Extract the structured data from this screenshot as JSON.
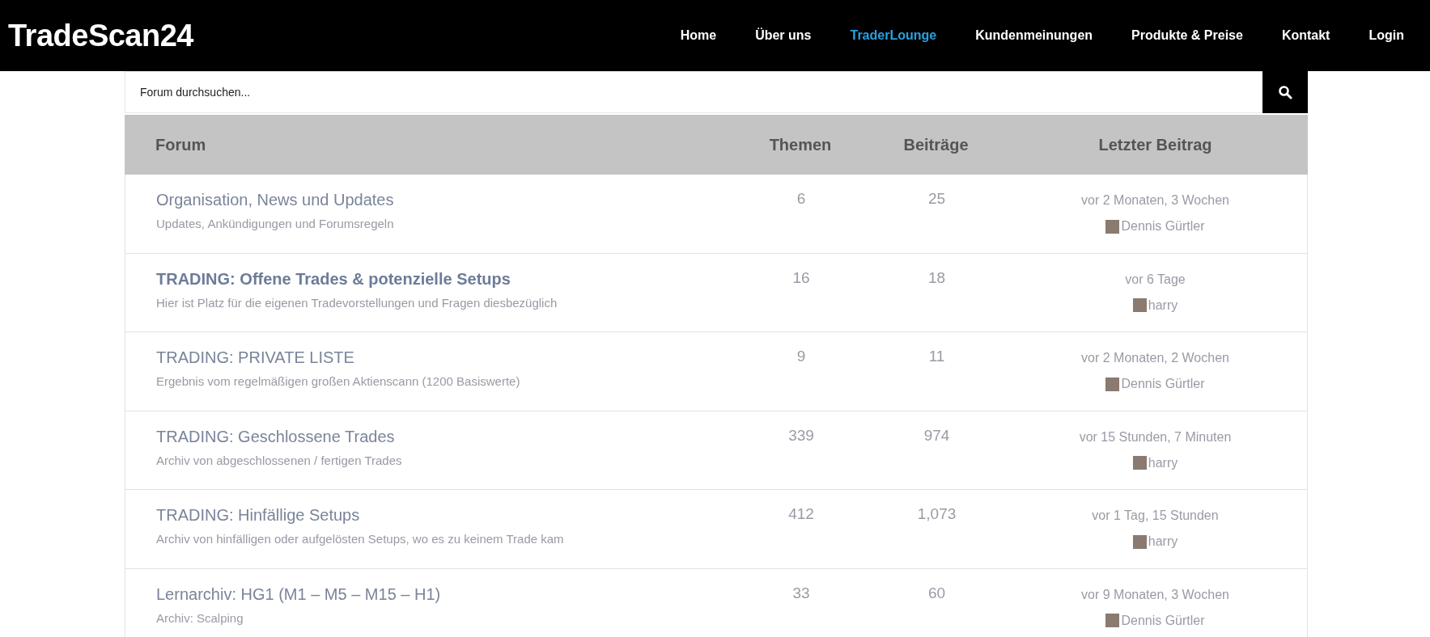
{
  "brand": "TradeScan24",
  "nav": [
    {
      "label": "Home",
      "selected": false
    },
    {
      "label": "Über uns",
      "selected": false
    },
    {
      "label": "TraderLounge",
      "selected": true
    },
    {
      "label": "Kundenmeinungen",
      "selected": false
    },
    {
      "label": "Produkte & Preise",
      "selected": false
    },
    {
      "label": "Kontakt",
      "selected": false
    },
    {
      "label": "Login",
      "selected": false
    }
  ],
  "search": {
    "placeholder": "Forum durchsuchen..."
  },
  "table": {
    "columns": [
      "Forum",
      "Themen",
      "Beiträge",
      "Letzter Beitrag"
    ],
    "rows": [
      {
        "title": "Organisation, News und Updates",
        "description": "Updates, Ankündigungen und Forumsregeln",
        "unread": false,
        "topics": "6",
        "posts": "25",
        "last_time": "vor 2 Monaten, 3 Wochen",
        "last_user": "Dennis Gürtler"
      },
      {
        "title": "TRADING: Offene Trades & potenzielle Setups",
        "description": "Hier ist Platz für die eigenen Tradevorstellungen und Fragen diesbezüglich",
        "unread": true,
        "topics": "16",
        "posts": "18",
        "last_time": "vor 6 Tage",
        "last_user": "harry"
      },
      {
        "title": "TRADING: PRIVATE LISTE",
        "description": "Ergebnis vom regelmäßigen großen Aktienscann (1200 Basiswerte)",
        "unread": false,
        "topics": "9",
        "posts": "11",
        "last_time": "vor 2 Monaten, 2 Wochen",
        "last_user": "Dennis Gürtler"
      },
      {
        "title": "TRADING: Geschlossene Trades",
        "description": "Archiv von abgeschlossenen / fertigen Trades",
        "unread": false,
        "topics": "339",
        "posts": "974",
        "last_time": "vor 15 Stunden, 7 Minuten",
        "last_user": "harry"
      },
      {
        "title": "TRADING: Hinfällige Setups",
        "description": "Archiv von hinfälligen oder aufgelösten Setups, wo es zu keinem Trade kam",
        "unread": false,
        "topics": "412",
        "posts": "1,073",
        "last_time": "vor 1 Tag, 15 Stunden",
        "last_user": "harry"
      },
      {
        "title": "Lernarchiv: HG1 (M1 – M5 – M15 – H1)",
        "description": "Archiv: Scalping",
        "unread": false,
        "topics": "33",
        "posts": "60",
        "last_time": "vor 9 Monaten, 3 Wochen",
        "last_user": "Dennis Gürtler"
      }
    ]
  }
}
